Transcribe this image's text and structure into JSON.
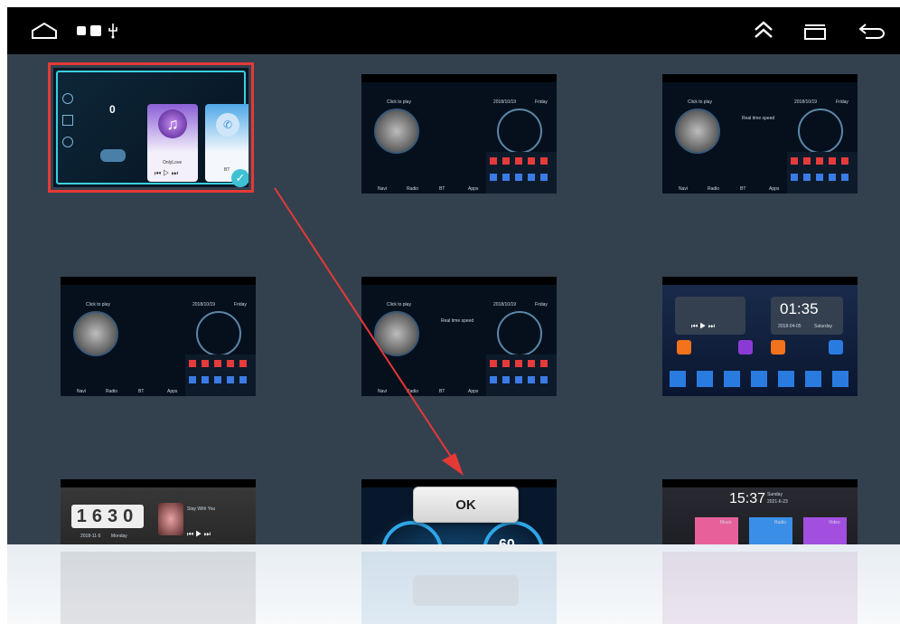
{
  "status_bar": {
    "home_icon": "home-outline-icon",
    "right_icons": [
      "double-chevron-up-icon",
      "recent-apps-icon",
      "back-icon"
    ]
  },
  "ok_button": {
    "label": "OK"
  },
  "themes": [
    {
      "id": "theme-1",
      "style": "cards",
      "selected": true,
      "labels": [
        "0",
        "OnlyLove",
        "BT"
      ]
    },
    {
      "id": "theme-2",
      "style": "dashboard",
      "labels": [
        "Click to play",
        "2018/10/19",
        "Friday",
        "Navi",
        "Radio",
        "BT",
        "Apps"
      ]
    },
    {
      "id": "theme-3",
      "style": "dashboard",
      "labels": [
        "Click to play",
        "2018/10/19",
        "Friday",
        "Real time speed",
        "Navi",
        "Radio",
        "BT",
        "Apps"
      ]
    },
    {
      "id": "theme-4",
      "style": "dashboard",
      "labels": [
        "Click to play",
        "2018/10/19",
        "Friday",
        "Navi",
        "Radio",
        "BT",
        "Apps"
      ]
    },
    {
      "id": "theme-5",
      "style": "dashboard",
      "labels": [
        "Click to play",
        "2018/10/19",
        "Friday",
        "Real time speed",
        "Navi",
        "Radio",
        "BT",
        "Apps"
      ]
    },
    {
      "id": "theme-6",
      "style": "clock",
      "labels": [
        "01:35",
        "2018-04-05",
        "Saturday"
      ]
    },
    {
      "id": "theme-7",
      "style": "flipclock",
      "labels": [
        "1630",
        "2018-11-5",
        "Monday",
        "Stay With You"
      ]
    },
    {
      "id": "theme-8",
      "style": "gauges",
      "labels": [
        "60"
      ]
    },
    {
      "id": "theme-9",
      "style": "tiles",
      "labels": [
        "15:37",
        "Sunday",
        "2021-6-23",
        "Music",
        "Radio",
        "Video"
      ]
    }
  ],
  "colors": {
    "screen_bg": "#33414f",
    "selection_border": "#e53935",
    "arrow": "#e53935"
  }
}
